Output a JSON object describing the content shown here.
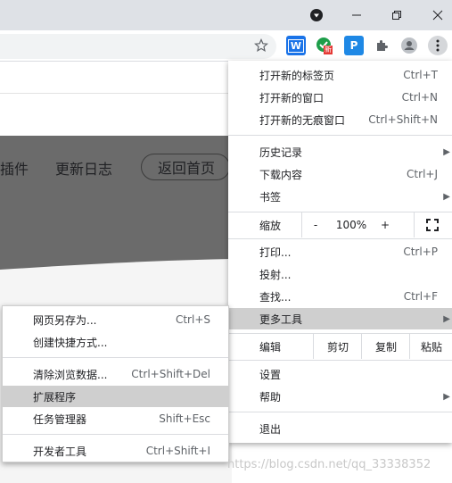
{
  "browser": {
    "window_controls": {
      "dropdown": "▼",
      "minimize": "—",
      "restore": "❐",
      "close": "✕"
    },
    "extensions": [
      {
        "name": "bookmark-star-icon"
      },
      {
        "name": "word-extension-icon",
        "text": "W"
      },
      {
        "name": "translate-extension-icon",
        "badge": "新"
      },
      {
        "name": "p-extension-icon",
        "text": "P"
      },
      {
        "name": "extensions-puzzle-icon"
      },
      {
        "name": "profile-icon"
      },
      {
        "name": "menu-kebab-icon"
      }
    ]
  },
  "page": {
    "nav_plugins": "插件",
    "nav_changelog": "更新日志",
    "home_button": "返回首页",
    "watermark": "https://blog.csdn.net/qq_33338352"
  },
  "menu": {
    "new_tab": {
      "label": "打开新的标签页",
      "shortcut": "Ctrl+T"
    },
    "new_window": {
      "label": "打开新的窗口",
      "shortcut": "Ctrl+N"
    },
    "incognito": {
      "label": "打开新的无痕窗口",
      "shortcut": "Ctrl+Shift+N"
    },
    "history": {
      "label": "历史记录"
    },
    "downloads": {
      "label": "下载内容",
      "shortcut": "Ctrl+J"
    },
    "bookmarks": {
      "label": "书签"
    },
    "zoom": {
      "label": "缩放",
      "minus": "-",
      "value": "100%",
      "plus": "+"
    },
    "print": {
      "label": "打印...",
      "shortcut": "Ctrl+P"
    },
    "cast": {
      "label": "投射..."
    },
    "find": {
      "label": "查找...",
      "shortcut": "Ctrl+F"
    },
    "more_tools": {
      "label": "更多工具"
    },
    "edit": {
      "label": "编辑",
      "cut": "剪切",
      "copy": "复制",
      "paste": "粘贴"
    },
    "settings": {
      "label": "设置"
    },
    "help": {
      "label": "帮助"
    },
    "exit": {
      "label": "退出"
    }
  },
  "submenu": {
    "save_page": {
      "label": "网页另存为...",
      "shortcut": "Ctrl+S"
    },
    "create_shortcut": {
      "label": "创建快捷方式..."
    },
    "clear_data": {
      "label": "清除浏览数据...",
      "shortcut": "Ctrl+Shift+Del"
    },
    "extensions": {
      "label": "扩展程序"
    },
    "task_manager": {
      "label": "任务管理器",
      "shortcut": "Shift+Esc"
    },
    "dev_tools": {
      "label": "开发者工具",
      "shortcut": "Ctrl+Shift+I"
    }
  },
  "colors": {
    "titlebar": "#dee1e6",
    "highlight": "#cfcfcf",
    "page_band": "#6b6b6b"
  }
}
